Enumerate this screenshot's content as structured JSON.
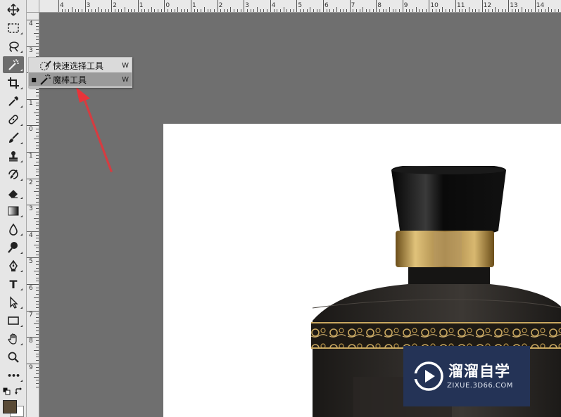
{
  "ruler": {
    "top_labels": [
      "4",
      "3",
      "2",
      "1",
      "0",
      "1",
      "2",
      "3",
      "4",
      "5",
      "6",
      "7",
      "8",
      "9",
      "10",
      "11",
      "12",
      "13",
      "14"
    ],
    "left_labels": [
      "4",
      "3",
      "2",
      "1",
      "0",
      "1",
      "2",
      "3",
      "4",
      "5",
      "6",
      "7",
      "8",
      "9"
    ]
  },
  "flyout": {
    "items": [
      {
        "label": "快速选择工具",
        "shortcut": "W",
        "selected": false
      },
      {
        "label": "魔棒工具",
        "shortcut": "W",
        "selected": true
      }
    ]
  },
  "toolbar": {
    "tools": [
      {
        "name": "move-tool",
        "icon": "move-icon"
      },
      {
        "name": "marquee-tool",
        "icon": "rect-marquee-icon"
      },
      {
        "name": "lasso-tool",
        "icon": "lasso-icon"
      },
      {
        "name": "magic-wand-tool",
        "icon": "magic-wand-icon",
        "active": true
      },
      {
        "name": "crop-tool",
        "icon": "crop-icon"
      },
      {
        "name": "eyedropper-tool",
        "icon": "eyedropper-icon"
      },
      {
        "name": "healing-brush-tool",
        "icon": "bandage-icon"
      },
      {
        "name": "brush-tool",
        "icon": "brush-icon"
      },
      {
        "name": "stamp-tool",
        "icon": "stamp-icon"
      },
      {
        "name": "history-brush-tool",
        "icon": "history-brush-icon"
      },
      {
        "name": "eraser-tool",
        "icon": "eraser-icon"
      },
      {
        "name": "gradient-tool",
        "icon": "gradient-icon"
      },
      {
        "name": "blur-tool",
        "icon": "drop-icon"
      },
      {
        "name": "dodge-tool",
        "icon": "dodge-icon"
      },
      {
        "name": "pen-tool",
        "icon": "pen-icon"
      },
      {
        "name": "type-tool",
        "icon": "type-icon",
        "glyph": "T"
      },
      {
        "name": "path-selection-tool",
        "icon": "arrow-icon"
      },
      {
        "name": "shape-tool",
        "icon": "rectangle-icon"
      },
      {
        "name": "hand-tool",
        "icon": "hand-icon"
      },
      {
        "name": "zoom-tool",
        "icon": "zoom-icon"
      },
      {
        "name": "more-tools",
        "icon": "ellipsis-icon",
        "glyph": "•••"
      }
    ]
  },
  "colors": {
    "foreground": "#594a36",
    "background": "#ffffff",
    "arrow": "#e8343a",
    "watermark_bg": "#243356"
  },
  "watermark": {
    "title": "溜溜自学",
    "url": "ZIXUE.3D66.COM"
  }
}
